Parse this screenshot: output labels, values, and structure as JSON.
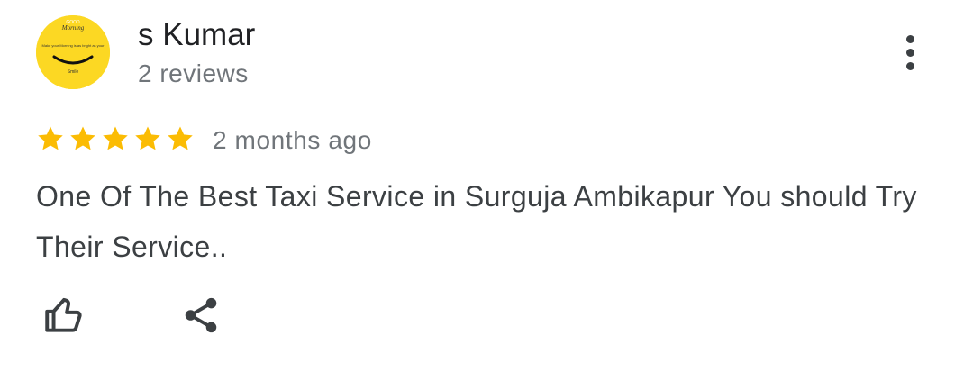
{
  "review": {
    "author_name": "s Kumar",
    "review_count": "2 reviews",
    "rating": 5,
    "rating_max": 5,
    "time_ago": "2 months ago",
    "text": "One Of The Best Taxi Service in Surguja Ambikapur You should Try Their Service.."
  },
  "avatar": {
    "background": "#fcd823",
    "text_top": "GOOD",
    "text_morning": "Morning",
    "text_middle": "Make your Morning is as bright as your",
    "text_bottom": "Smile"
  },
  "icons": {
    "more": "more-vert-icon",
    "like": "thumb-up-outline-icon",
    "share": "share-icon",
    "star": "star-icon"
  },
  "colors": {
    "star": "#fbbc04",
    "name": "#202124",
    "secondary": "#70757a",
    "body": "#3c4043"
  }
}
